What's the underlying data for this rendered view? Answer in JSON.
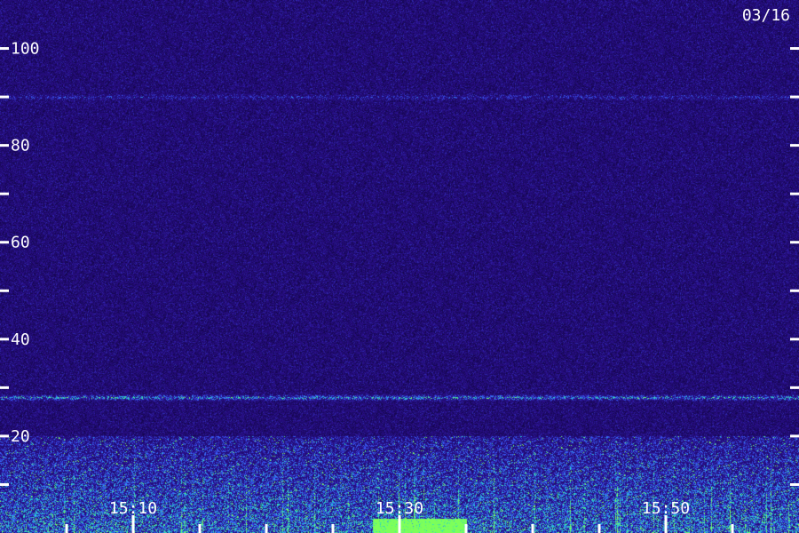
{
  "chart_data": {
    "type": "heatmap",
    "title": "",
    "date_label": "03/16",
    "xlabel": "",
    "ylabel": "",
    "y_axis": {
      "range": [
        0,
        110
      ],
      "major_ticks": [
        20,
        40,
        60,
        80,
        100
      ],
      "tick_labels": [
        "20",
        "40",
        "60",
        "80",
        "100"
      ],
      "minor_ticks": [
        10,
        30,
        50,
        70,
        90
      ]
    },
    "x_axis": {
      "start": "15:00",
      "end": "15:59",
      "major_ticks": [
        "15:10",
        "15:30",
        "15:50"
      ],
      "tick_labels": [
        "15:10",
        "15:30",
        "15:50"
      ],
      "minor_ticks": [
        "15:05",
        "15:15",
        "15:20",
        "15:25",
        "15:35",
        "15:40",
        "15:45",
        "15:55"
      ]
    },
    "features": [
      {
        "name": "band",
        "y": 28,
        "x_start": "15:00",
        "x_end": "15:59",
        "intensity": "medium"
      },
      {
        "name": "band",
        "y": 90,
        "x_start": "15:00",
        "x_end": "15:59",
        "intensity": "low"
      },
      {
        "name": "broadband",
        "y_range": [
          0,
          20
        ],
        "x_start": "15:00",
        "x_end": "15:59",
        "intensity": "high"
      },
      {
        "name": "burst",
        "y_range": [
          0,
          3
        ],
        "x_start": "15:28",
        "x_end": "15:35",
        "intensity": "high"
      }
    ],
    "colors": {
      "background": "#1f0b6e",
      "low": "#2a0f8a",
      "mid": "#3a5cff",
      "high": "#22e0c8",
      "peak": "#7dff5a",
      "text": "#ffffff"
    }
  }
}
